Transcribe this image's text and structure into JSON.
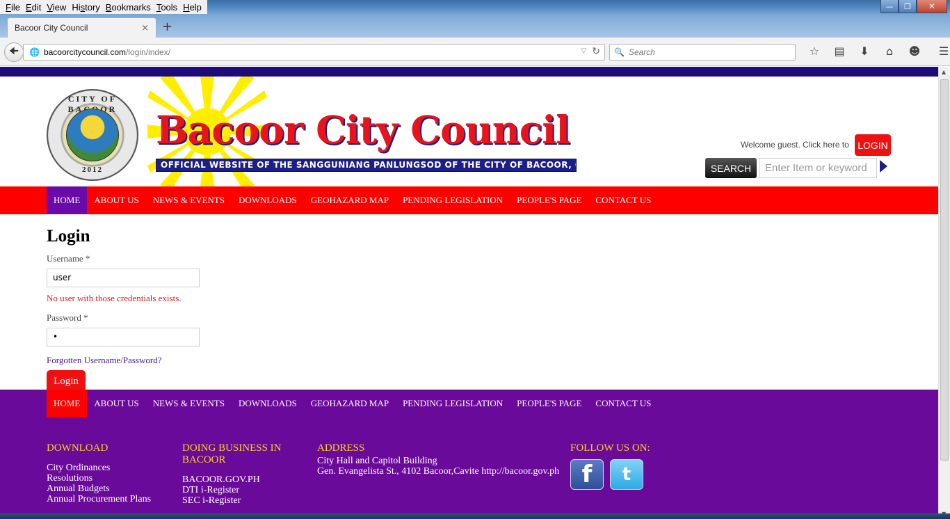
{
  "browser": {
    "menu": [
      "File",
      "Edit",
      "View",
      "History",
      "Bookmarks",
      "Tools",
      "Help"
    ],
    "menu_accel": [
      "F",
      "E",
      "V",
      "s",
      "B",
      "T",
      "H"
    ],
    "tab_title": "Bacoor City Council",
    "tab_close": "×",
    "new_tab": "+",
    "url_host": "bacoorcitycouncil.com",
    "url_path": "/login/index/",
    "search_placeholder": "Search"
  },
  "header": {
    "seal_ring": "CITY OF BACOOR",
    "seal_year": "2012",
    "site_title": "Bacoor City Council",
    "site_subtitle": "OFFICIAL WEBSITE OF THE SANGGUNIANG PANLUNGSOD OF THE CITY OF BACOOR, CAVITE",
    "welcome_text": "Welcome guest. Click here to",
    "login_label": "LOGIN",
    "search_label": "SEARCH",
    "search_placeholder": "Enter Item or keyword"
  },
  "nav": [
    "HOME",
    "ABOUT US",
    "NEWS & EVENTS",
    "DOWNLOADS",
    "GEOHAZARD MAP",
    "PENDING LEGISLATION",
    "PEOPLE'S PAGE",
    "CONTACT US"
  ],
  "login_form": {
    "heading": "Login",
    "username_label": "Username *",
    "username_value": "user",
    "error": "No user with those credentials exists.",
    "password_label": "Password *",
    "password_value": "•",
    "forgot": "Forgotten Username/Password?",
    "submit": "Login"
  },
  "footer": {
    "download": {
      "heading": "DOWNLOAD",
      "items": [
        "City Ordinances",
        "Resolutions",
        "Annual Budgets",
        "Annual Procurement Plans"
      ]
    },
    "business": {
      "heading_line1": "DOING BUSINESS IN",
      "heading_line2": "BACOOR",
      "items": [
        "BACOOR.GOV.PH",
        "DTI i-Register",
        "SEC i-Register"
      ]
    },
    "address": {
      "heading": "ADDRESS",
      "lines": [
        "City Hall and Capitol Building",
        "Gen. Evangelista St., 4102 Bacoor,Cavite http://bacoor.gov.ph"
      ]
    },
    "follow": {
      "heading": "FOLLOW US ON:",
      "facebook_glyph": "f",
      "twitter_glyph": "t"
    }
  },
  "colors": {
    "nav_red": "#ff0000",
    "purple": "#6a0a9a",
    "top_strip": "#1e0a7a",
    "footer_heading": "#ffd21f"
  }
}
